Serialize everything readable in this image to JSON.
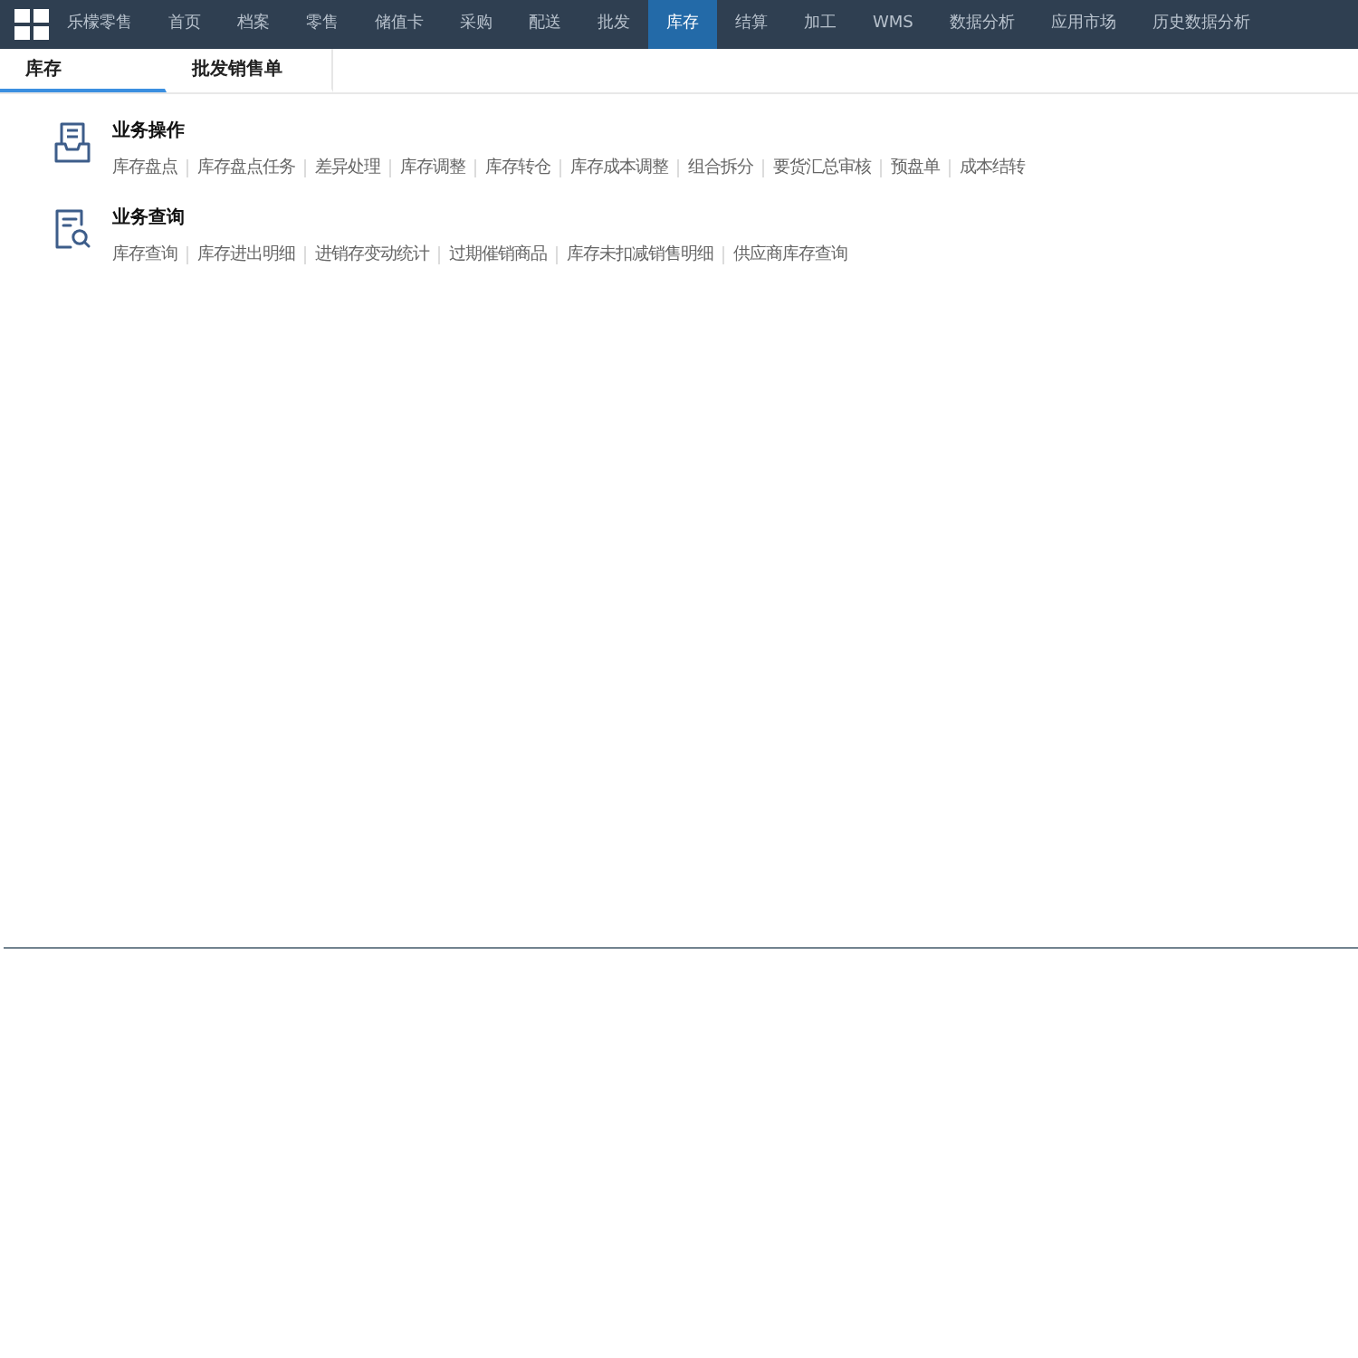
{
  "top_nav": {
    "items": [
      {
        "label": "乐檬零售",
        "selected": false
      },
      {
        "label": "首页",
        "selected": false
      },
      {
        "label": "档案",
        "selected": false
      },
      {
        "label": "零售",
        "selected": false
      },
      {
        "label": "储值卡",
        "selected": false
      },
      {
        "label": "采购",
        "selected": false
      },
      {
        "label": "配送",
        "selected": false
      },
      {
        "label": "批发",
        "selected": false
      },
      {
        "label": "库存",
        "selected": true
      },
      {
        "label": "结算",
        "selected": false
      },
      {
        "label": "加工",
        "selected": false
      },
      {
        "label": "WMS",
        "selected": false
      },
      {
        "label": "数据分析",
        "selected": false
      },
      {
        "label": "应用市场",
        "selected": false
      },
      {
        "label": "历史数据分析",
        "selected": false
      }
    ]
  },
  "tabs": [
    {
      "label": "库存",
      "selected": true
    },
    {
      "label": "批发销售单",
      "selected": false
    }
  ],
  "sections": [
    {
      "kind": "operations",
      "title": "业务操作",
      "links": [
        "库存盘点",
        "库存盘点任务",
        "差异处理",
        "库存调整",
        "库存转仓",
        "库存成本调整",
        "组合拆分",
        "要货汇总审核",
        "预盘单",
        "成本结转"
      ]
    },
    {
      "kind": "queries",
      "title": "业务查询",
      "links": [
        "库存查询",
        "库存进出明细",
        "进销存变动统计",
        "过期催销商品",
        "库存未扣减销售明细",
        "供应商库存查询"
      ]
    }
  ]
}
